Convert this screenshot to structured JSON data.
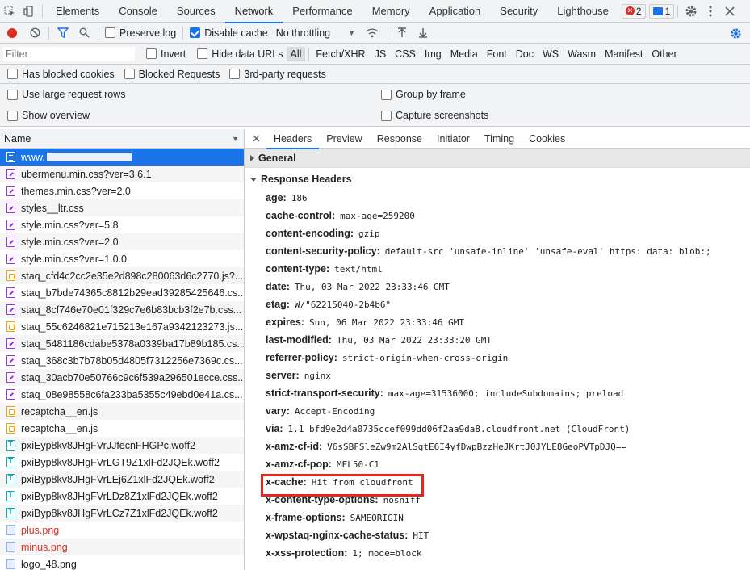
{
  "tabs": [
    "Elements",
    "Console",
    "Sources",
    "Network",
    "Performance",
    "Memory",
    "Application",
    "Security",
    "Lighthouse"
  ],
  "active_tab": "Network",
  "error_count": "2",
  "message_count": "1",
  "toolbar": {
    "preserve_log": "Preserve log",
    "disable_cache": "Disable cache",
    "throttling": "No throttling"
  },
  "filter": {
    "placeholder": "Filter",
    "invert": "Invert",
    "hide_data_urls": "Hide data URLs",
    "types": [
      "All",
      "Fetch/XHR",
      "JS",
      "CSS",
      "Img",
      "Media",
      "Font",
      "Doc",
      "WS",
      "Wasm",
      "Manifest",
      "Other"
    ]
  },
  "blocked": {
    "has_blocked_cookies": "Has blocked cookies",
    "blocked_requests": "Blocked Requests",
    "third_party": "3rd-party requests"
  },
  "settings": {
    "large_rows": "Use large request rows",
    "overview": "Show overview",
    "group_by_frame": "Group by frame",
    "capture_screenshots": "Capture screenshots"
  },
  "name_header": "Name",
  "requests": [
    {
      "name": "www.",
      "type": "doc"
    },
    {
      "name": "ubermenu.min.css?ver=3.6.1",
      "type": "css"
    },
    {
      "name": "themes.min.css?ver=2.0",
      "type": "css"
    },
    {
      "name": "styles__ltr.css",
      "type": "css"
    },
    {
      "name": "style.min.css?ver=5.8",
      "type": "css"
    },
    {
      "name": "style.min.css?ver=2.0",
      "type": "css"
    },
    {
      "name": "style.min.css?ver=1.0.0",
      "type": "css"
    },
    {
      "name": "staq_cfd4c2cc2e35e2d898c280063d6c2770.js?...",
      "type": "js"
    },
    {
      "name": "staq_b7bde74365c8812b29ead39285425646.cs...",
      "type": "css"
    },
    {
      "name": "staq_8cf746e70e01f329c7e6b83bcb3f2e7b.css...",
      "type": "css"
    },
    {
      "name": "staq_55c6246821e715213e167a9342123273.js...",
      "type": "js"
    },
    {
      "name": "staq_5481186cdabe5378a0339ba17b89b185.cs...",
      "type": "css"
    },
    {
      "name": "staq_368c3b7b78b05d4805f7312256e7369c.cs...",
      "type": "css"
    },
    {
      "name": "staq_30acb70e50766c9c6f539a296501ecce.css...",
      "type": "css"
    },
    {
      "name": "staq_08e98558c6fa233ba5355c49ebd0e41a.cs...",
      "type": "css"
    },
    {
      "name": "recaptcha__en.js",
      "type": "js"
    },
    {
      "name": "recaptcha__en.js",
      "type": "js"
    },
    {
      "name": "pxiEyp8kv8JHgFVrJJfecnFHGPc.woff2",
      "type": "font"
    },
    {
      "name": "pxiByp8kv8JHgFVrLGT9Z1xlFd2JQEk.woff2",
      "type": "font"
    },
    {
      "name": "pxiByp8kv8JHgFVrLEj6Z1xlFd2JQEk.woff2",
      "type": "font"
    },
    {
      "name": "pxiByp8kv8JHgFVrLDz8Z1xlFd2JQEk.woff2",
      "type": "font"
    },
    {
      "name": "pxiByp8kv8JHgFVrLCz7Z1xlFd2JQEk.woff2",
      "type": "font"
    },
    {
      "name": "plus.png",
      "type": "img",
      "red": true
    },
    {
      "name": "minus.png",
      "type": "img",
      "red": true
    },
    {
      "name": "logo_48.png",
      "type": "img"
    }
  ],
  "detail_tabs": [
    "Headers",
    "Preview",
    "Response",
    "Initiator",
    "Timing",
    "Cookies"
  ],
  "active_detail_tab": "Headers",
  "sections": {
    "general": "General",
    "response_headers": "Response Headers"
  },
  "headers": [
    {
      "k": "age:",
      "v": "186"
    },
    {
      "k": "cache-control:",
      "v": "max-age=259200"
    },
    {
      "k": "content-encoding:",
      "v": "gzip"
    },
    {
      "k": "content-security-policy:",
      "v": "default-src 'unsafe-inline' 'unsafe-eval' https: data: blob:;"
    },
    {
      "k": "content-type:",
      "v": "text/html"
    },
    {
      "k": "date:",
      "v": "Thu, 03 Mar 2022 23:33:46 GMT"
    },
    {
      "k": "etag:",
      "v": "W/\"62215040-2b4b6\""
    },
    {
      "k": "expires:",
      "v": "Sun, 06 Mar 2022 23:33:46 GMT"
    },
    {
      "k": "last-modified:",
      "v": "Thu, 03 Mar 2022 23:33:20 GMT"
    },
    {
      "k": "referrer-policy:",
      "v": "strict-origin-when-cross-origin"
    },
    {
      "k": "server:",
      "v": "nginx"
    },
    {
      "k": "strict-transport-security:",
      "v": "max-age=31536000; includeSubdomains; preload"
    },
    {
      "k": "vary:",
      "v": "Accept-Encoding"
    },
    {
      "k": "via:",
      "v": "1.1 bfd9e2d4a0735ccef099dd06f2aa9da8.cloudfront.net (CloudFront)"
    },
    {
      "k": "x-amz-cf-id:",
      "v": "V6sSBFSleZw9m2AlSgtE6I4yfDwpBzzHeJKrtJ0JYLE8GeoPVTpDJQ=="
    },
    {
      "k": "x-amz-cf-pop:",
      "v": "MEL50-C1"
    },
    {
      "k": "x-cache:",
      "v": "Hit from cloudfront"
    },
    {
      "k": "x-content-type-options:",
      "v": "nosniff"
    },
    {
      "k": "x-frame-options:",
      "v": "SAMEORIGIN"
    },
    {
      "k": "x-wpstaq-nginx-cache-status:",
      "v": "HIT"
    },
    {
      "k": "x-xss-protection:",
      "v": "1; mode=block"
    }
  ],
  "highlight_color": "#e8261c"
}
